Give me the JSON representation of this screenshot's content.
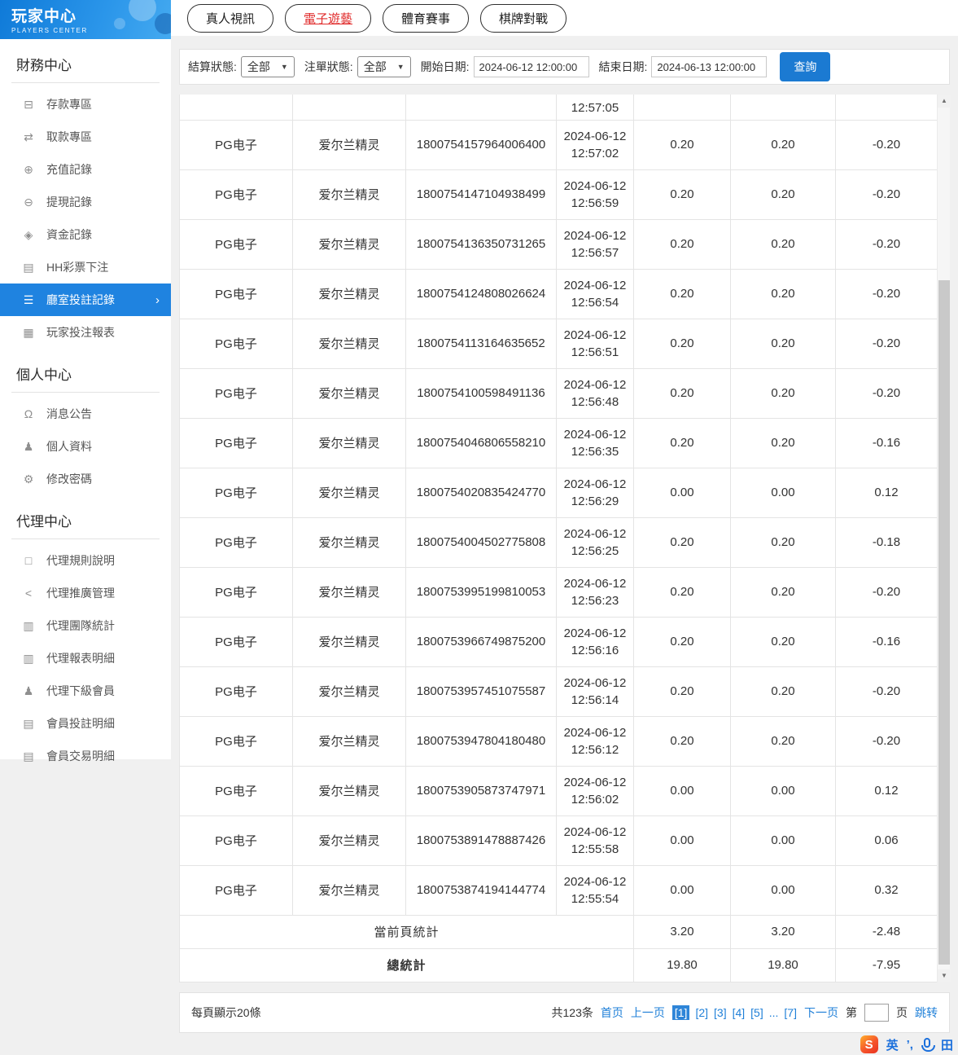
{
  "app": {
    "title": "玩家中心",
    "subtitle": "PLAYERS CENTER"
  },
  "sidebar": {
    "sections": [
      {
        "heading": "財務中心",
        "items": [
          {
            "label": "存款專區",
            "icon": "deposit-icon",
            "glyph": "⊟"
          },
          {
            "label": "取款專區",
            "icon": "withdraw-icon",
            "glyph": "⇄"
          },
          {
            "label": "充值記錄",
            "icon": "recharge-record-icon",
            "glyph": "⊕"
          },
          {
            "label": "提現記錄",
            "icon": "withdrawal-record-icon",
            "glyph": "⊖"
          },
          {
            "label": "資金記錄",
            "icon": "funds-record-icon",
            "glyph": "◈"
          },
          {
            "label": "HH彩票下注",
            "icon": "lottery-bet-icon",
            "glyph": "▤"
          },
          {
            "label": "廳室投註記錄",
            "icon": "room-bet-record-icon",
            "glyph": "☰",
            "active": true
          },
          {
            "label": "玩家投注報表",
            "icon": "player-bet-report-icon",
            "glyph": "▦"
          }
        ]
      },
      {
        "heading": "個人中心",
        "items": [
          {
            "label": "消息公告",
            "icon": "bell-icon",
            "glyph": "Ω"
          },
          {
            "label": "個人資料",
            "icon": "user-icon",
            "glyph": "♟"
          },
          {
            "label": "修改密碼",
            "icon": "gear-icon",
            "glyph": "⚙"
          }
        ]
      },
      {
        "heading": "代理中心",
        "items": [
          {
            "label": "代理規則說明",
            "icon": "document-icon",
            "glyph": "□"
          },
          {
            "label": "代理推廣管理",
            "icon": "share-icon",
            "glyph": "<"
          },
          {
            "label": "代理團隊統計",
            "icon": "team-stats-icon",
            "glyph": "▥"
          },
          {
            "label": "代理報表明細",
            "icon": "report-detail-icon",
            "glyph": "▥"
          },
          {
            "label": "代理下級會員",
            "icon": "members-icon",
            "glyph": "♟"
          },
          {
            "label": "會員投註明細",
            "icon": "member-bet-detail-icon",
            "glyph": "▤"
          },
          {
            "label": "會員交易明細",
            "icon": "member-transaction-icon",
            "glyph": "▤"
          }
        ]
      }
    ]
  },
  "tabs": [
    {
      "label": "真人視訊"
    },
    {
      "label": "電子遊藝",
      "active": true
    },
    {
      "label": "體育賽事"
    },
    {
      "label": "棋牌對戰"
    }
  ],
  "filters": {
    "settle_status_label": "結算狀態:",
    "settle_status_value": "全部",
    "order_status_label": "注單狀態:",
    "order_status_value": "全部",
    "start_label": "開始日期:",
    "start_value": "2024-06-12 12:00:00",
    "end_label": "結束日期:",
    "end_value": "2024-06-13 12:00:00",
    "query_label": "查詢"
  },
  "table": {
    "partial_row_time": "12:57:05",
    "rows": [
      {
        "platform": "PG电子",
        "game": "爱尔兰精灵",
        "id": "1800754157964006400",
        "date": "2024-06-12",
        "time": "12:57:02",
        "bet": "0.20",
        "valid": "0.20",
        "profit": "-0.20"
      },
      {
        "platform": "PG电子",
        "game": "爱尔兰精灵",
        "id": "1800754147104938499",
        "date": "2024-06-12",
        "time": "12:56:59",
        "bet": "0.20",
        "valid": "0.20",
        "profit": "-0.20"
      },
      {
        "platform": "PG电子",
        "game": "爱尔兰精灵",
        "id": "1800754136350731265",
        "date": "2024-06-12",
        "time": "12:56:57",
        "bet": "0.20",
        "valid": "0.20",
        "profit": "-0.20"
      },
      {
        "platform": "PG电子",
        "game": "爱尔兰精灵",
        "id": "1800754124808026624",
        "date": "2024-06-12",
        "time": "12:56:54",
        "bet": "0.20",
        "valid": "0.20",
        "profit": "-0.20"
      },
      {
        "platform": "PG电子",
        "game": "爱尔兰精灵",
        "id": "1800754113164635652",
        "date": "2024-06-12",
        "time": "12:56:51",
        "bet": "0.20",
        "valid": "0.20",
        "profit": "-0.20"
      },
      {
        "platform": "PG电子",
        "game": "爱尔兰精灵",
        "id": "1800754100598491136",
        "date": "2024-06-12",
        "time": "12:56:48",
        "bet": "0.20",
        "valid": "0.20",
        "profit": "-0.20"
      },
      {
        "platform": "PG电子",
        "game": "爱尔兰精灵",
        "id": "1800754046806558210",
        "date": "2024-06-12",
        "time": "12:56:35",
        "bet": "0.20",
        "valid": "0.20",
        "profit": "-0.16"
      },
      {
        "platform": "PG电子",
        "game": "爱尔兰精灵",
        "id": "1800754020835424770",
        "date": "2024-06-12",
        "time": "12:56:29",
        "bet": "0.00",
        "valid": "0.00",
        "profit": "0.12"
      },
      {
        "platform": "PG电子",
        "game": "爱尔兰精灵",
        "id": "1800754004502775808",
        "date": "2024-06-12",
        "time": "12:56:25",
        "bet": "0.20",
        "valid": "0.20",
        "profit": "-0.18"
      },
      {
        "platform": "PG电子",
        "game": "爱尔兰精灵",
        "id": "1800753995199810053",
        "date": "2024-06-12",
        "time": "12:56:23",
        "bet": "0.20",
        "valid": "0.20",
        "profit": "-0.20"
      },
      {
        "platform": "PG电子",
        "game": "爱尔兰精灵",
        "id": "1800753966749875200",
        "date": "2024-06-12",
        "time": "12:56:16",
        "bet": "0.20",
        "valid": "0.20",
        "profit": "-0.16"
      },
      {
        "platform": "PG电子",
        "game": "爱尔兰精灵",
        "id": "1800753957451075587",
        "date": "2024-06-12",
        "time": "12:56:14",
        "bet": "0.20",
        "valid": "0.20",
        "profit": "-0.20"
      },
      {
        "platform": "PG电子",
        "game": "爱尔兰精灵",
        "id": "1800753947804180480",
        "date": "2024-06-12",
        "time": "12:56:12",
        "bet": "0.20",
        "valid": "0.20",
        "profit": "-0.20"
      },
      {
        "platform": "PG电子",
        "game": "爱尔兰精灵",
        "id": "1800753905873747971",
        "date": "2024-06-12",
        "time": "12:56:02",
        "bet": "0.00",
        "valid": "0.00",
        "profit": "0.12"
      },
      {
        "platform": "PG电子",
        "game": "爱尔兰精灵",
        "id": "1800753891478887426",
        "date": "2024-06-12",
        "time": "12:55:58",
        "bet": "0.00",
        "valid": "0.00",
        "profit": "0.06"
      },
      {
        "platform": "PG电子",
        "game": "爱尔兰精灵",
        "id": "1800753874194144774",
        "date": "2024-06-12",
        "time": "12:55:54",
        "bet": "0.00",
        "valid": "0.00",
        "profit": "0.32"
      }
    ],
    "current_page_label": "當前頁統計",
    "current_page_totals": [
      "3.20",
      "3.20",
      "-2.48"
    ],
    "total_label": "總統計",
    "total_totals": [
      "19.80",
      "19.80",
      "-7.95"
    ]
  },
  "pagination": {
    "per_page": "每頁顯示20條",
    "total": "共123条",
    "first": "首页",
    "prev": "上一页",
    "page_items": [
      {
        "text": "[1]",
        "current": true
      },
      {
        "text": "[2]"
      },
      {
        "text": "[3]"
      },
      {
        "text": "[4]"
      },
      {
        "text": "[5]"
      },
      {
        "text": "...",
        "ellipsis": true
      },
      {
        "text": "[7]"
      }
    ],
    "next": "下一页",
    "jump_prefix": "第",
    "jump_suffix": "页",
    "jump_action": "跳转"
  },
  "ime": {
    "logo": "S",
    "lang": "英",
    "punct": "’,",
    "grid": "田"
  }
}
